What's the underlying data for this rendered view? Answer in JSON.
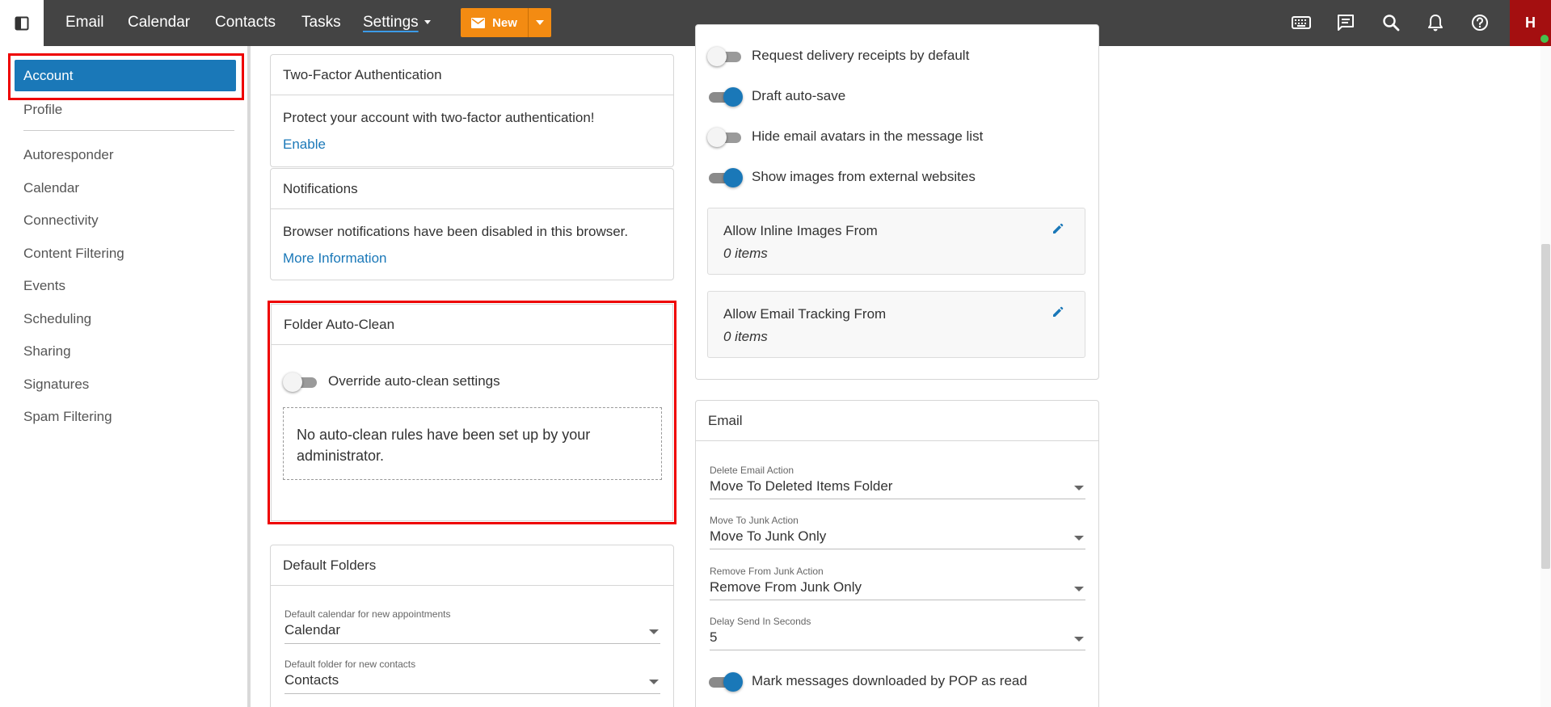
{
  "nav": {
    "items": [
      {
        "label": "Email"
      },
      {
        "label": "Calendar"
      },
      {
        "label": "Contacts"
      },
      {
        "label": "Tasks"
      },
      {
        "label": "Settings"
      }
    ],
    "new_label": "New",
    "avatar_initial": "H",
    "icons": [
      "keyboard-icon",
      "chat-icon",
      "search-icon",
      "bell-icon",
      "help-icon"
    ]
  },
  "sidebar": {
    "items": [
      {
        "label": "Account"
      },
      {
        "label": "Profile"
      },
      {
        "label": "Autoresponder"
      },
      {
        "label": "Calendar"
      },
      {
        "label": "Connectivity"
      },
      {
        "label": "Content Filtering"
      },
      {
        "label": "Events"
      },
      {
        "label": "Scheduling"
      },
      {
        "label": "Sharing"
      },
      {
        "label": "Signatures"
      },
      {
        "label": "Spam Filtering"
      }
    ]
  },
  "two_factor": {
    "title": "Two-Factor Authentication",
    "text": "Protect your account with two-factor authentication!",
    "link": "Enable"
  },
  "notifications": {
    "title": "Notifications",
    "text": "Browser notifications have been disabled in this browser.",
    "link": "More Information"
  },
  "auto_clean": {
    "title": "Folder Auto-Clean",
    "toggle_label": "Override auto-clean settings",
    "toggle_on": false,
    "notice": "No auto-clean rules have been set up by your administrator."
  },
  "default_folders": {
    "title": "Default Folders",
    "fields": [
      {
        "label": "Default calendar for new appointments",
        "value": "Calendar"
      },
      {
        "label": "Default folder for new contacts",
        "value": "Contacts"
      }
    ]
  },
  "general_toggles": [
    {
      "label": "Request delivery receipts by default",
      "on": false
    },
    {
      "label": "Draft auto-save",
      "on": true
    },
    {
      "label": "Hide email avatars in the message list",
      "on": false
    },
    {
      "label": "Show images from external websites",
      "on": true
    }
  ],
  "allow_lists": [
    {
      "title": "Allow Inline Images From",
      "value": "0 items"
    },
    {
      "title": "Allow Email Tracking From",
      "value": "0 items"
    }
  ],
  "email": {
    "title": "Email",
    "fields": [
      {
        "label": "Delete Email Action",
        "value": "Move To Deleted Items Folder"
      },
      {
        "label": "Move To Junk Action",
        "value": "Move To Junk Only"
      },
      {
        "label": "Remove From Junk Action",
        "value": "Remove From Junk Only"
      },
      {
        "label": "Delay Send In Seconds",
        "value": "5"
      }
    ],
    "toggle_label": "Mark messages downloaded by POP as read",
    "toggle_on": true
  },
  "colors": {
    "topbar": "#444444",
    "accent": "#1a78b8",
    "new_button": "#f38b12",
    "avatar": "#a40f10",
    "highlight": "#ee0000"
  }
}
